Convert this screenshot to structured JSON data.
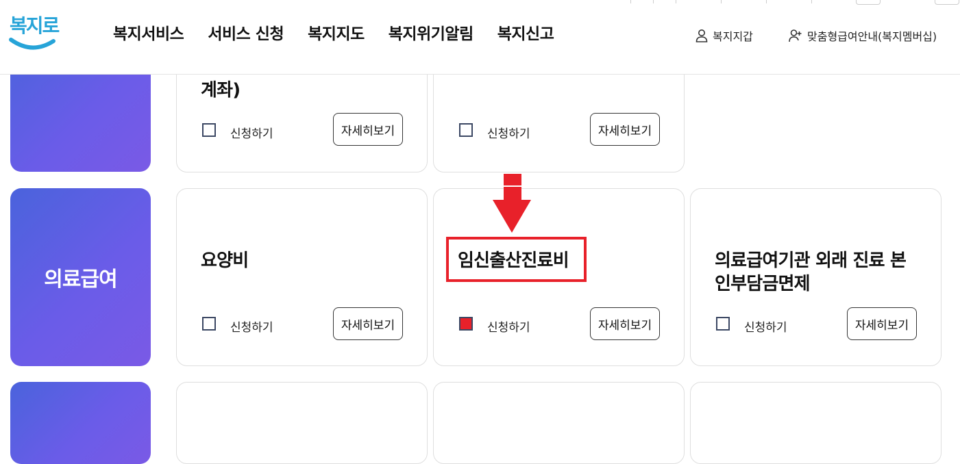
{
  "header": {
    "logo_text": "복지로",
    "nav": [
      "복지서비스",
      "서비스 신청",
      "복지지도",
      "복지위기알림",
      "복지신고"
    ],
    "wallet_label": "복지지갑",
    "membership_label": "맞춤형급여안내(복지멤버십)"
  },
  "common": {
    "apply_label": "신청하기",
    "detail_label": "자세히보기"
  },
  "rows": [
    {
      "category": "",
      "cards": [
        {
          "title_lines": [
            "계좌)"
          ],
          "checked": false
        },
        {
          "title_lines": [],
          "checked": false
        }
      ]
    },
    {
      "category": "의료급여",
      "cards": [
        {
          "title_lines": [
            "요양비"
          ],
          "checked": false
        },
        {
          "title_lines": [
            "임신출산진료비"
          ],
          "checked": true
        },
        {
          "title_lines": [
            "의료급여기관 외래 진료 본",
            "인부담금면제"
          ],
          "checked": false
        }
      ]
    },
    {
      "category": "",
      "cards": []
    }
  ],
  "annotation": {
    "arrow_color": "#e8212a"
  },
  "colors": {
    "brand_blue": "#27a4d8",
    "category_gradient_start": "#4a63dc",
    "category_gradient_end": "#7a5ae6",
    "checked_red": "#e8212a"
  }
}
